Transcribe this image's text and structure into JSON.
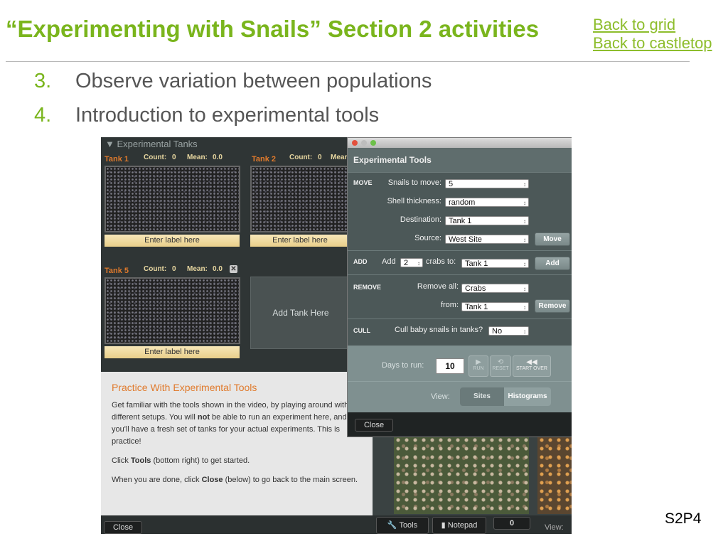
{
  "slide": {
    "title": "“Experimenting with Snails” Section 2 activities",
    "links": [
      "Back to grid",
      "Back to castletop"
    ],
    "items": [
      {
        "num": "3.",
        "text": "Observe variation between populations"
      },
      {
        "num": "4.",
        "text": "Introduction to experimental tools"
      }
    ],
    "page_label": "S2P4",
    "colors": {
      "title": "#7ab51d",
      "link": "#8dbd2c"
    }
  },
  "app": {
    "panel_header": "▼  Experimental Tanks",
    "tanks": [
      {
        "name": "Tank 1",
        "count_label": "Count:",
        "count": "0",
        "mean_label": "Mean:",
        "mean": "0.0",
        "label_placeholder": "Enter label here"
      },
      {
        "name": "Tank 2",
        "count_label": "Count:",
        "count": "0",
        "mean_label": "Mear",
        "label_placeholder": "Enter label here"
      },
      {
        "name": "Tank 5",
        "count_label": "Count:",
        "count": "0",
        "mean_label": "Mean:",
        "mean": "0.0",
        "label_placeholder": "Enter label here"
      }
    ],
    "add_tank_label": "Add Tank Here",
    "practice": {
      "title": "Practice With Experimental Tools",
      "p1a": "Get familiar with the tools shown in the video, by playing around with different setups. You will ",
      "p1b": "not",
      "p1c": " be able to run an experiment here, and you'll have a fresh set of tanks for your actual experiments. This is practice!",
      "p2a": "Click ",
      "p2b": "Tools",
      "p2c": " (bottom right) to get started.",
      "p3a": "When you are done, click ",
      "p3b": "Close",
      "p3c": " (below) to go back to the main screen."
    },
    "bottom": {
      "close": "Close",
      "tools": "Tools",
      "notepad": "Notepad",
      "counter": "0",
      "view": "View:"
    }
  },
  "tools": {
    "title": "Experimental Tools",
    "move": {
      "label": "MOVE",
      "snails_label": "Snails to move:",
      "snails_value": "5",
      "thickness_label": "Shell thickness:",
      "thickness_value": "random",
      "dest_label": "Destination:",
      "dest_value": "Tank 1",
      "source_label": "Source:",
      "source_value": "West Site",
      "button": "Move"
    },
    "add": {
      "label": "ADD",
      "add_word": "Add",
      "count": "2",
      "crabs_to": "crabs to:",
      "tank": "Tank 1",
      "button": "Add"
    },
    "remove": {
      "label": "REMOVE",
      "all_label": "Remove all:",
      "all_value": "Crabs",
      "from_label": "from:",
      "from_value": "Tank 1",
      "button": "Remove"
    },
    "cull": {
      "label": "CULL",
      "question": "Cull baby snails in tanks?",
      "value": "No"
    },
    "run": {
      "days_label": "Days to run:",
      "days": "10",
      "run": "RUN",
      "reset": "RESET",
      "start_over": "START OVER"
    },
    "view": {
      "label": "View:",
      "sites": "Sites",
      "histograms": "Histograms"
    },
    "close": "Close"
  }
}
